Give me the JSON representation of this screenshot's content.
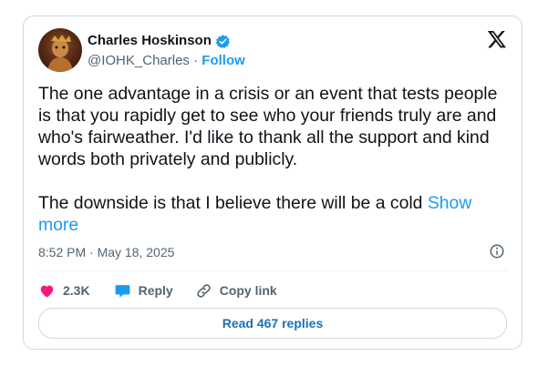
{
  "author": {
    "name": "Charles Hoskinson",
    "handle": "@IOHK_Charles",
    "separator": "·",
    "follow_label": "Follow"
  },
  "tweet": {
    "paragraph1": "The one advantage in a crisis or an event that tests people is that you rapidly get to see who your friends truly are and who's fairweather. I'd like to thank all the support and kind words both privately and publicly.",
    "paragraph2": "The downside is that I believe there will be a cold",
    "show_more_label": "Show more",
    "timestamp": "8:52 PM · May 18, 2025"
  },
  "actions": {
    "like_count": "2.3K",
    "reply_label": "Reply",
    "copy_link_label": "Copy link"
  },
  "read_replies_label": "Read 467 replies",
  "icons": {
    "platform": "x-logo-icon",
    "verified": "verified-badge-icon",
    "like": "heart-icon",
    "reply": "speech-bubble-icon",
    "copy": "link-icon",
    "info": "info-icon"
  },
  "colors": {
    "accent": "#1d9bf0",
    "like": "#f91880",
    "muted": "#536471",
    "text": "#0f1419"
  }
}
